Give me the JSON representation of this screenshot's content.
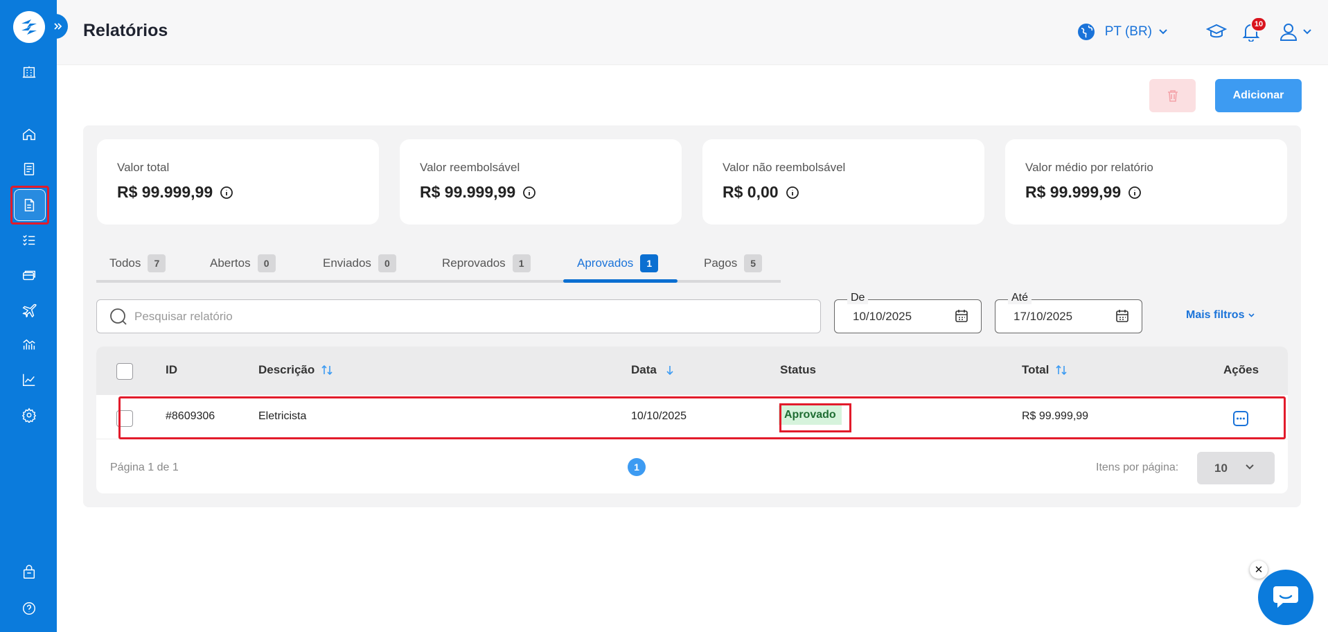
{
  "header": {
    "title": "Relatórios",
    "language": "PT (BR)",
    "notification_count": "10"
  },
  "toolbar": {
    "add_label": "Adicionar"
  },
  "cards": [
    {
      "label": "Valor total",
      "value": "R$ 99.999,99"
    },
    {
      "label": "Valor reembolsável",
      "value": "R$ 99.999,99"
    },
    {
      "label": "Valor não reembolsável",
      "value": "R$ 0,00"
    },
    {
      "label": "Valor médio por relatório",
      "value": "R$ 99.999,99"
    }
  ],
  "tabs": [
    {
      "label": "Todos",
      "count": "7"
    },
    {
      "label": "Abertos",
      "count": "0"
    },
    {
      "label": "Enviados",
      "count": "0"
    },
    {
      "label": "Reprovados",
      "count": "1"
    },
    {
      "label": "Aprovados",
      "count": "1",
      "active": true
    },
    {
      "label": "Pagos",
      "count": "5"
    }
  ],
  "filters": {
    "search_placeholder": "Pesquisar relatório",
    "from_label": "De",
    "from_value": "10/10/2025",
    "to_label": "Até",
    "to_value": "17/10/2025",
    "more_filters": "Mais filtros"
  },
  "table": {
    "columns": [
      "ID",
      "Descrição",
      "Data",
      "Status",
      "Total",
      "Ações"
    ],
    "rows": [
      {
        "id": "#8609306",
        "description": "Eletricista",
        "date": "10/10/2025",
        "status": "Aprovado",
        "total": "R$ 99.999,99"
      }
    ]
  },
  "pagination": {
    "page_text": "Página 1 de 1",
    "current_page": "1",
    "items_per_page_label": "Itens por página:",
    "items_per_page_value": "10"
  },
  "colors": {
    "brand": "#0b7bdc",
    "accent": "#1a73d9",
    "add_button": "#3d9bf2",
    "status_approved_bg": "#d6f3dc",
    "highlight": "#e21b2b"
  },
  "icons": {
    "sidebar": [
      "building-icon",
      "home-icon",
      "receipt-icon",
      "report-icon",
      "checklist-icon",
      "card-icon",
      "plane-icon",
      "analytics-icon",
      "chart-icon",
      "settings-icon",
      "bag-icon",
      "help-icon"
    ]
  }
}
